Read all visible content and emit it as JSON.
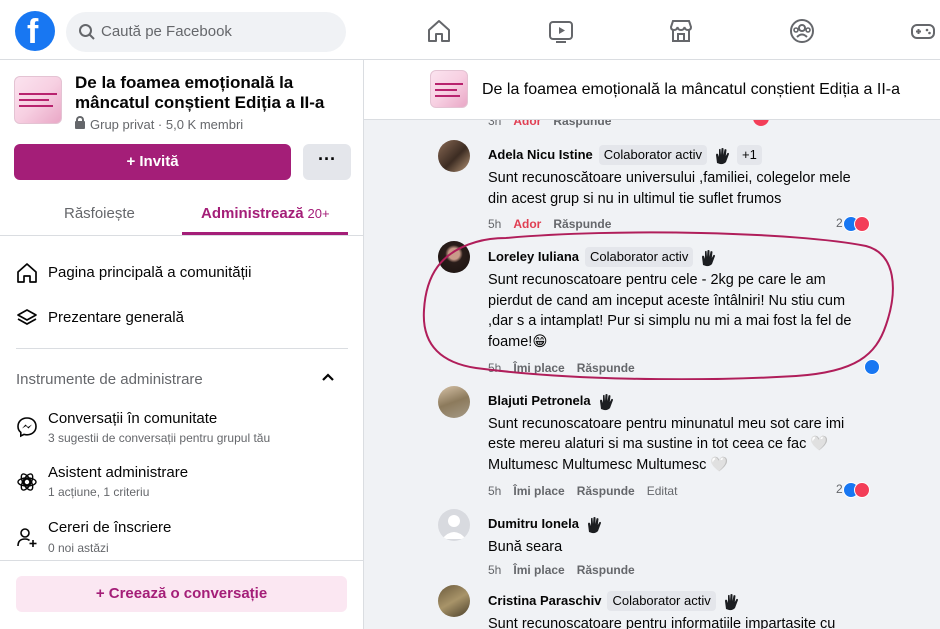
{
  "search": {
    "placeholder": "Caută pe Facebook"
  },
  "nav": {
    "icons": [
      "home-icon",
      "video-icon",
      "marketplace-icon",
      "groups-icon",
      "gaming-icon"
    ]
  },
  "group": {
    "name": "De la foamea emoțională la mâncatul conștient Ediția a II-a",
    "privacy": "Grup privat",
    "members": "5,0 K membri",
    "invite_label": "Invită",
    "more_label": "···"
  },
  "tabs": {
    "browse": "Răsfoiește",
    "admin": "Administrează",
    "admin_count": "20+"
  },
  "menu": {
    "community_home": "Pagina principală a comunității",
    "overview": "Prezentare generală"
  },
  "admin_tools": {
    "title": "Instrumente de administrare",
    "items": [
      {
        "label": "Conversații în comunitate",
        "sub": "3 sugestii de conversații pentru grupul tău"
      },
      {
        "label": "Asistent administrare",
        "sub": "1 acțiune, 1 criteriu"
      },
      {
        "label": "Cereri de înscriere",
        "sub": "0 noi astăzi"
      }
    ]
  },
  "create_label": "Creează o conversație",
  "header_title": "De la foamea emoțională la mâncatul conștient Ediția a II-a",
  "top_partial": {
    "time": "3h",
    "adore": "Ador",
    "reply": "Răspunde"
  },
  "comments": [
    {
      "name": "Adela Nicu Istine",
      "badge": "Colaborator activ",
      "plus": "+1",
      "text": "Sunt recunoscătoare universului ,familiei, colegelor mele din acest grup si nu in ultimul tie suflet frumos",
      "time": "5h",
      "action": "Ador",
      "reply": "Răspunde",
      "reaction_count": "2"
    },
    {
      "name": "Loreley Iuliana",
      "badge": "Colaborator activ",
      "text": "Sunt recunoscatoare pentru cele - 2kg pe care le am pierdut de cand am inceput aceste întâlniri! Nu stiu cum ,dar s a intamplat! Pur si simplu nu mi a mai fost la fel de foame!😁",
      "time": "5h",
      "action": "Îmi place",
      "reply": "Răspunde"
    },
    {
      "name": "Blajuti Petronela",
      "text": "Sunt recunoscatoare pentru minunatul meu sot care imi este mereu alaturi si ma sustine in tot ceea ce fac 🤍 Multumesc Multumesc Multumesc 🤍",
      "time": "5h",
      "action": "Îmi place",
      "reply": "Răspunde",
      "edited": "Editat",
      "reaction_count": "2"
    },
    {
      "name": "Dumitru Ionela",
      "text": "Bună seara",
      "time": "5h",
      "action": "Îmi place",
      "reply": "Răspunde"
    },
    {
      "name": "Cristina Paraschiv",
      "badge": "Colaborator activ",
      "text": "Sunt recunoscatoare pentru informatiile impartasite cu",
      "time": "",
      "action": "",
      "reply": ""
    }
  ],
  "colors": {
    "brand": "#1877f2",
    "group_accent": "#a41e78",
    "highlight_circle": "#b01e5a"
  }
}
